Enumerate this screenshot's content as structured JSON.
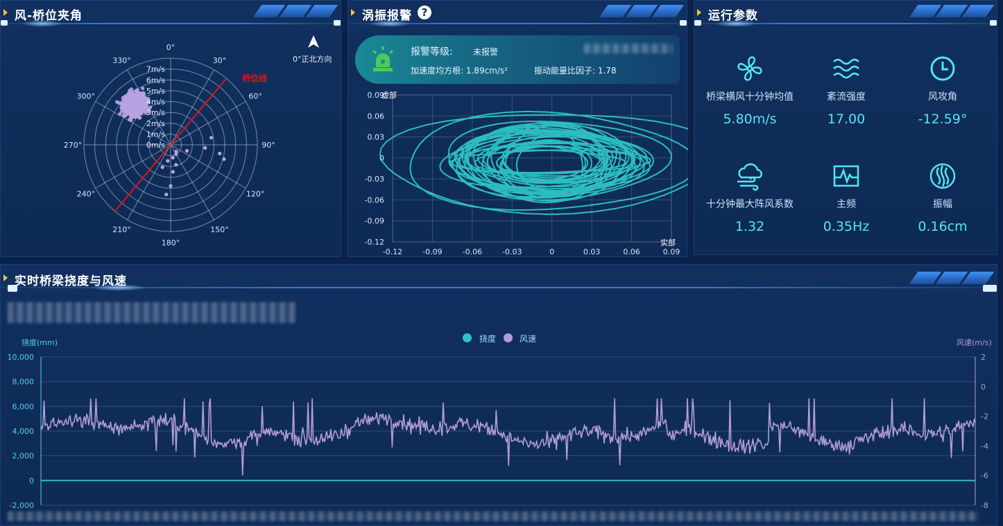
{
  "panels": {
    "polar": {
      "title": "风-桥位夹角",
      "north_note": "0°正北方向",
      "bridge_line_label": "桥位线"
    },
    "vortex": {
      "title": "涡振报警"
    },
    "params": {
      "title": "运行参数"
    },
    "deflection": {
      "title": "实时桥梁挠度与风速"
    }
  },
  "alarm": {
    "level_label": "报警等级:",
    "level_value": "未报警",
    "accel_text": "加速度均方根: 1.89cm/s²",
    "energy_text": "振动能量比因子: 1.78"
  },
  "params": [
    {
      "label": "桥梁横风十分钟均值",
      "value": "5.80m/s",
      "icon": "fan-icon"
    },
    {
      "label": "紊流强度",
      "value": "17.00",
      "icon": "waves-icon"
    },
    {
      "label": "风攻角",
      "value": "-12.59°",
      "icon": "clock-icon"
    },
    {
      "label": "十分钟最大阵风系数",
      "value": "1.32",
      "icon": "cloud-wind-icon"
    },
    {
      "label": "主频",
      "value": "0.35Hz",
      "icon": "pulse-icon"
    },
    {
      "label": "振幅",
      "value": "0.16cm",
      "icon": "amplitude-icon"
    }
  ],
  "colors": {
    "accent": "#2ec4c6",
    "wind": "#b39ddb",
    "bridge_line": "#e01515",
    "title_arrow": "#f5c542",
    "value": "#55e6f0"
  },
  "chart_data": [
    {
      "type": "scatter",
      "subtype": "polar",
      "angle_ticks": [
        "0°",
        "30°",
        "60°",
        "90°",
        "120°",
        "150°",
        "180°",
        "210°",
        "240°",
        "270°",
        "300°",
        "330°"
      ],
      "radius_ticks": [
        "0m/s",
        "1m/s",
        "2m/s",
        "3m/s",
        "4m/s",
        "5m/s",
        "6m/s",
        "7m/s"
      ],
      "bridge_line_angle": 40,
      "series": [
        {
          "name": "",
          "cluster_center_angle": 318,
          "cluster_center_speed": 5.0
        }
      ]
    },
    {
      "type": "line",
      "subtype": "orbit",
      "xlabel": "实部",
      "ylabel": "虚部",
      "xlim": [
        -0.12,
        0.09
      ],
      "ylim": [
        -0.12,
        0.09
      ],
      "x_ticks": [
        "-0.12",
        "-0.09",
        "-0.06",
        "-0.03",
        "0",
        "0.03",
        "0.06",
        "0.09"
      ],
      "y_ticks": [
        "0.09",
        "0.06",
        "0.03",
        "0",
        "-0.03",
        "-0.06",
        "-0.09",
        "-0.12"
      ]
    },
    {
      "type": "line",
      "legend": [
        "挠度",
        "风速"
      ],
      "ylabel_left": "挠度(mm)",
      "ylabel_right": "风速(m/s)",
      "ylim_left": [
        -2000,
        10000
      ],
      "ylim_right": [
        -8,
        2
      ],
      "y_ticks_left": [
        "10,000",
        "8,000",
        "6,000",
        "4,000",
        "2,000",
        "0",
        "-2,000"
      ],
      "y_ticks_right": [
        "2",
        "0",
        "-2",
        "-4",
        "-6",
        "-8"
      ],
      "series": [
        {
          "name": "挠度",
          "value_constant": 0
        },
        {
          "name": "风速",
          "range": [
            -6.4,
            -0.8
          ]
        }
      ]
    }
  ]
}
